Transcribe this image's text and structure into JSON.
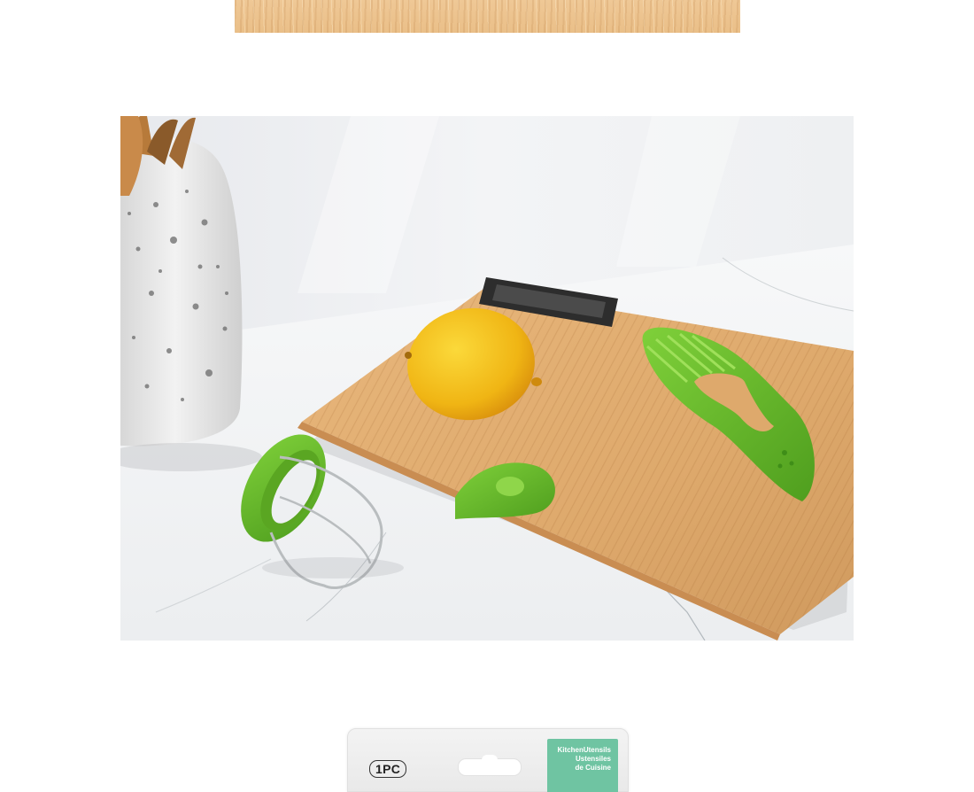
{
  "package": {
    "quantity_label": "1PC",
    "label_line1": "KitchenUtensils",
    "label_line2": "Ustensiles",
    "label_line3": "de Cuisine"
  },
  "colors": {
    "bamboo": "#e7b982",
    "accent_green": "#6cbf2f",
    "label_green": "#6fc4a2",
    "lemon": "#f4c21c"
  },
  "icons": [
    "utensil-holder",
    "lemon",
    "avocado-tool",
    "cutting-board",
    "mango-splitter"
  ]
}
